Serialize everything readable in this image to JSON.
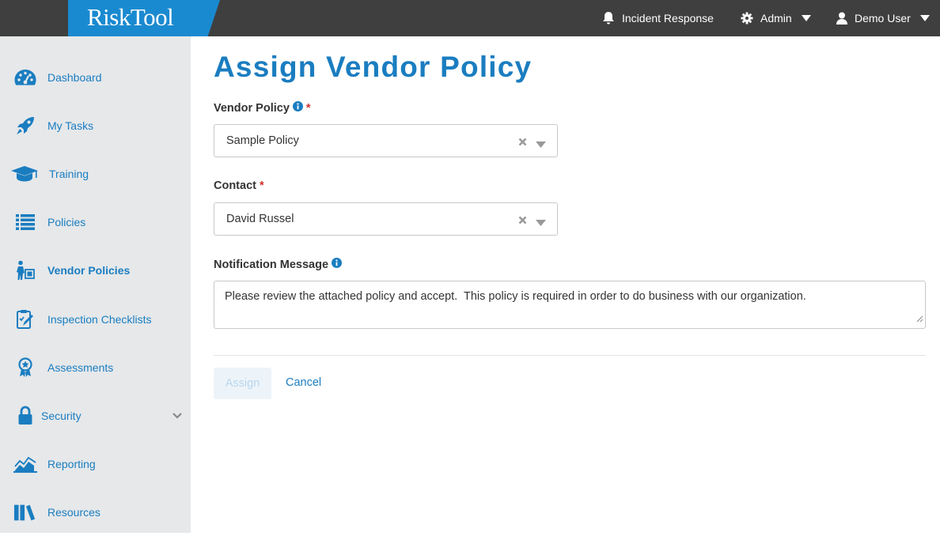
{
  "brand": {
    "logo_text": "RiskTool",
    "accent": "#1a8ad0",
    "link_color": "#1a7dc0",
    "topbar_color": "#3f3f3f"
  },
  "topnav": {
    "incident": {
      "label": "Incident Response",
      "icon": "bell-icon"
    },
    "admin": {
      "label": "Admin",
      "icon": "gear-icon"
    },
    "user": {
      "label": "Demo User",
      "icon": "user-icon"
    }
  },
  "sidebar": {
    "items": [
      {
        "label": "Dashboard",
        "icon": "dashboard-icon"
      },
      {
        "label": "My Tasks",
        "icon": "rocket-icon"
      },
      {
        "label": "Training",
        "icon": "graduation-cap-icon"
      },
      {
        "label": "Policies",
        "icon": "list-icon"
      },
      {
        "label": "Vendor Policies",
        "icon": "vendor-icon",
        "active": true
      },
      {
        "label": "Inspection Checklists",
        "icon": "checklist-icon"
      },
      {
        "label": "Assessments",
        "icon": "award-icon"
      },
      {
        "label": "Security",
        "icon": "lock-icon",
        "expandable": true
      },
      {
        "label": "Reporting",
        "icon": "chart-icon"
      },
      {
        "label": "Resources",
        "icon": "books-icon"
      }
    ]
  },
  "main": {
    "title": "Assign Vendor Policy",
    "vendor_policy": {
      "label": "Vendor Policy",
      "required": "*",
      "value": "Sample Policy"
    },
    "contact": {
      "label": "Contact",
      "required": "*",
      "value": "David Russel"
    },
    "notification": {
      "label": "Notification Message",
      "value": "Please review the attached policy and accept.  This policy is required in order to do business with our organization."
    },
    "assign_label": "Assign",
    "cancel_label": "Cancel"
  }
}
